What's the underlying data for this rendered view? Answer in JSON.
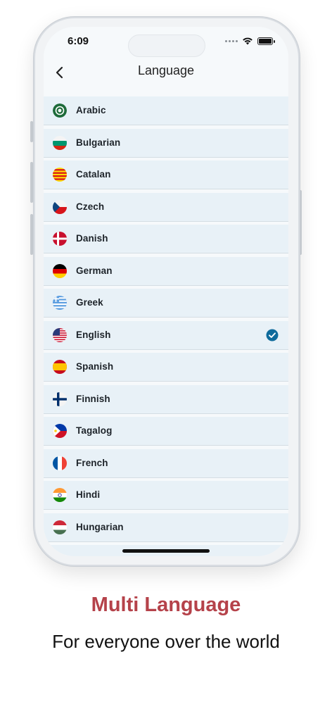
{
  "status_bar": {
    "time": "6:09"
  },
  "navbar": {
    "back_icon": "chevron-left-icon",
    "title": "Language"
  },
  "languages": [
    {
      "label": "Arabic",
      "flag": "arab-league-flag-icon",
      "selected": false
    },
    {
      "label": "Bulgarian",
      "flag": "bulgaria-flag-icon",
      "selected": false
    },
    {
      "label": "Catalan",
      "flag": "catalonia-flag-icon",
      "selected": false
    },
    {
      "label": "Czech",
      "flag": "czech-flag-icon",
      "selected": false
    },
    {
      "label": "Danish",
      "flag": "denmark-flag-icon",
      "selected": false
    },
    {
      "label": "German",
      "flag": "germany-flag-icon",
      "selected": false
    },
    {
      "label": "Greek",
      "flag": "greece-flag-icon",
      "selected": false
    },
    {
      "label": "English",
      "flag": "usa-flag-icon",
      "selected": true
    },
    {
      "label": "Spanish",
      "flag": "spain-flag-icon",
      "selected": false
    },
    {
      "label": "Finnish",
      "flag": "finland-flag-icon",
      "selected": false
    },
    {
      "label": "Tagalog",
      "flag": "philippines-flag-icon",
      "selected": false
    },
    {
      "label": "French",
      "flag": "france-flag-icon",
      "selected": false
    },
    {
      "label": "Hindi",
      "flag": "india-flag-icon",
      "selected": false
    },
    {
      "label": "Hungarian",
      "flag": "hungary-flag-icon",
      "selected": false
    }
  ],
  "colors": {
    "accent_check": "#0f6b9c",
    "headline": "#b5424a",
    "row_background": "#e8f1f7"
  },
  "promo": {
    "headline": "Multi Language",
    "subline": "For everyone over the world"
  }
}
